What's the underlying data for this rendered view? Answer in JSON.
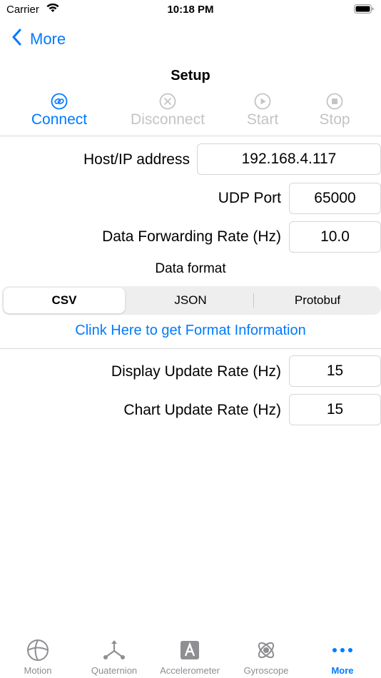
{
  "status_bar": {
    "carrier": "Carrier",
    "time": "10:18 PM"
  },
  "nav": {
    "back_label": "More",
    "title": "Setup"
  },
  "toolbar": {
    "connect": "Connect",
    "disconnect": "Disconnect",
    "start": "Start",
    "stop": "Stop"
  },
  "form": {
    "host_label": "Host/IP address",
    "host_value": "192.168.4.117",
    "udp_label": "UDP Port",
    "udp_value": "65000",
    "rate_label": "Data Forwarding Rate (Hz)",
    "rate_value": "10.0",
    "format_label": "Data format",
    "format_options": [
      "CSV",
      "JSON",
      "Protobuf"
    ],
    "format_selected": "CSV",
    "format_link": "Clink Here to get Format Information",
    "display_rate_label": "Display Update Rate (Hz)",
    "display_rate_value": "15",
    "chart_rate_label": "Chart Update Rate (Hz)",
    "chart_rate_value": "15"
  },
  "tabs": [
    {
      "label": "Motion",
      "icon": "globe-icon"
    },
    {
      "label": "Quaternion",
      "icon": "axes-icon"
    },
    {
      "label": "Accelerometer",
      "icon": "letter-a-icon"
    },
    {
      "label": "Gyroscope",
      "icon": "gyroscope-icon"
    },
    {
      "label": "More",
      "icon": "more-dots-icon",
      "active": true
    }
  ],
  "colors": {
    "accent": "#007aff",
    "disabled": "#c4c4c6",
    "inactive_tab": "#8e8e93"
  }
}
